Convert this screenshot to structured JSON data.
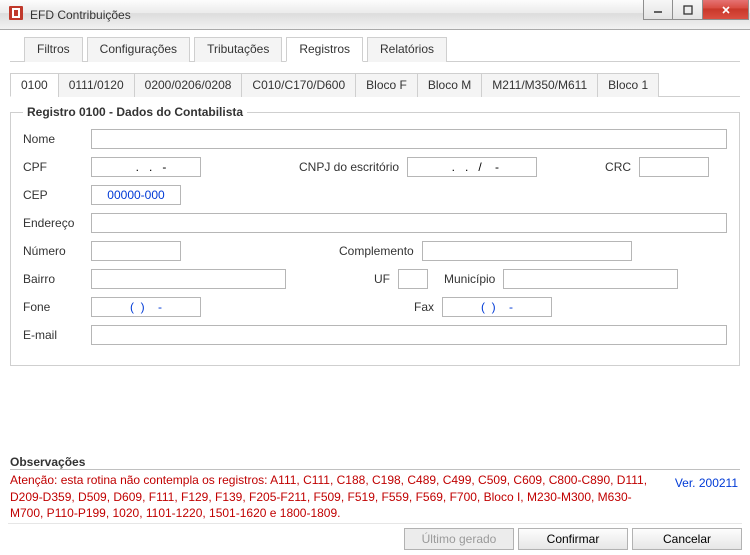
{
  "window": {
    "title": "EFD Contribuições"
  },
  "tabs": {
    "top": {
      "filtros": "Filtros",
      "configuracoes": "Configurações",
      "tributacoes": "Tributações",
      "registros": "Registros",
      "relatorios": "Relatórios",
      "active": "registros"
    },
    "sub": {
      "t0100": "0100",
      "t0111_0120": "0111/0120",
      "t0200_0206_0208": "0200/0206/0208",
      "tc010_c170_d600": "C010/C170/D600",
      "tbloco_f": "Bloco F",
      "tbloco_m": "Bloco M",
      "tm211_m350_m611": "M211/M350/M611",
      "tbloco_1": "Bloco 1",
      "active": "t0100"
    }
  },
  "group": {
    "legend": "Registro 0100 - Dados do Contabilista",
    "labels": {
      "nome": "Nome",
      "cpf": "CPF",
      "cnpj": "CNPJ do escritório",
      "crc": "CRC",
      "cep": "CEP",
      "endereco": "Endereço",
      "numero": "Número",
      "complemento": "Complemento",
      "bairro": "Bairro",
      "uf": "UF",
      "municipio": "Município",
      "fone": "Fone",
      "fax": "Fax",
      "email": "E-mail"
    },
    "values": {
      "nome": "",
      "cpf": "   .   .   -",
      "cnpj": "  .   .   /    -",
      "crc": "",
      "cep": "00000-000",
      "endereco": "",
      "numero": "",
      "complemento": "",
      "bairro": "",
      "uf": "",
      "municipio": "",
      "fone": "(  )    -",
      "fax": "(  )    -",
      "email": ""
    }
  },
  "observacoes": {
    "title": "Observações",
    "body": "Atenção: esta rotina não contempla os registros: A111, C111, C188, C198, C489, C499, C509, C609, C800-C890, D111, D209-D359, D509, D609, F111, F129, F139, F205-F211, F509, F519, F559, F569, F700, Bloco I, M230-M300, M630-M700, P110-P199, 1020, 1101-1220, 1501-1620 e 1800-1809."
  },
  "version": "Ver. 200211",
  "buttons": {
    "ultimo_gerado": "Último gerado",
    "confirmar": "Confirmar",
    "cancelar": "Cancelar"
  }
}
